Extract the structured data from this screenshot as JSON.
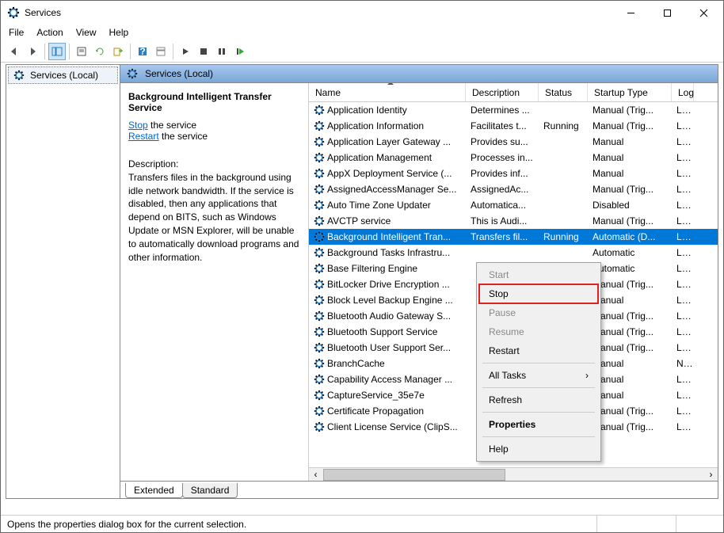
{
  "window": {
    "title": "Services"
  },
  "menu": {
    "file": "File",
    "action": "Action",
    "view": "View",
    "help": "Help"
  },
  "tree": {
    "root": "Services (Local)"
  },
  "contentHeader": "Services (Local)",
  "details": {
    "title": "Background Intelligent Transfer Service",
    "stop": "Stop",
    "stopsuffix": " the service",
    "restart": "Restart",
    "restartsuffix": " the service",
    "descLabel": "Description:",
    "desc": "Transfers files in the background using idle network bandwidth. If the service is disabled, then any applications that depend on BITS, such as Windows Update or MSN Explorer, will be unable to automatically download programs and other information."
  },
  "columns": {
    "name": "Name",
    "desc": "Description",
    "status": "Status",
    "start": "Startup Type",
    "log": "Log"
  },
  "services": [
    {
      "name": "Application Identity",
      "desc": "Determines ...",
      "status": "",
      "start": "Manual (Trig...",
      "log": "Loc"
    },
    {
      "name": "Application Information",
      "desc": "Facilitates t...",
      "status": "Running",
      "start": "Manual (Trig...",
      "log": "Loc"
    },
    {
      "name": "Application Layer Gateway ...",
      "desc": "Provides su...",
      "status": "",
      "start": "Manual",
      "log": "Loc"
    },
    {
      "name": "Application Management",
      "desc": "Processes in...",
      "status": "",
      "start": "Manual",
      "log": "Loc"
    },
    {
      "name": "AppX Deployment Service (...",
      "desc": "Provides inf...",
      "status": "",
      "start": "Manual",
      "log": "Loc"
    },
    {
      "name": "AssignedAccessManager Se...",
      "desc": "AssignedAc...",
      "status": "",
      "start": "Manual (Trig...",
      "log": "Loc"
    },
    {
      "name": "Auto Time Zone Updater",
      "desc": "Automatica...",
      "status": "",
      "start": "Disabled",
      "log": "Loc"
    },
    {
      "name": "AVCTP service",
      "desc": "This is Audi...",
      "status": "",
      "start": "Manual (Trig...",
      "log": "Loc"
    },
    {
      "name": "Background Intelligent Tran...",
      "desc": "Transfers fil...",
      "status": "Running",
      "start": "Automatic (D...",
      "log": "Loc",
      "selected": true
    },
    {
      "name": "Background Tasks Infrastru...",
      "desc": "",
      "status": "",
      "start": "Automatic",
      "log": "Loc"
    },
    {
      "name": "Base Filtering Engine",
      "desc": "",
      "status": "",
      "start": "Automatic",
      "log": "Loc"
    },
    {
      "name": "BitLocker Drive Encryption ...",
      "desc": "",
      "status": "",
      "start": "Manual (Trig...",
      "log": "Loc"
    },
    {
      "name": "Block Level Backup Engine ...",
      "desc": "",
      "status": "",
      "start": "Manual",
      "log": "Loc"
    },
    {
      "name": "Bluetooth Audio Gateway S...",
      "desc": "",
      "status": "",
      "start": "Manual (Trig...",
      "log": "Loc"
    },
    {
      "name": "Bluetooth Support Service",
      "desc": "",
      "status": "",
      "start": "Manual (Trig...",
      "log": "Loc"
    },
    {
      "name": "Bluetooth User Support Ser...",
      "desc": "",
      "status": "",
      "start": "Manual (Trig...",
      "log": "Loc"
    },
    {
      "name": "BranchCache",
      "desc": "",
      "status": "",
      "start": "Manual",
      "log": "Net"
    },
    {
      "name": "Capability Access Manager ...",
      "desc": "",
      "status": "",
      "start": "Manual",
      "log": "Loc"
    },
    {
      "name": "CaptureService_35e7e",
      "desc": "",
      "status": "",
      "start": "Manual",
      "log": "Loc"
    },
    {
      "name": "Certificate Propagation",
      "desc": "",
      "status": "",
      "start": "Manual (Trig...",
      "log": "Loc"
    },
    {
      "name": "Client License Service (ClipS...",
      "desc": "",
      "status": "",
      "start": "Manual (Trig...",
      "log": "Loc"
    }
  ],
  "context": {
    "start": "Start",
    "stop": "Stop",
    "pause": "Pause",
    "resume": "Resume",
    "restart": "Restart",
    "alltasks": "All Tasks",
    "refresh": "Refresh",
    "properties": "Properties",
    "help": "Help"
  },
  "tabs": {
    "extended": "Extended",
    "standard": "Standard"
  },
  "statusbar": "Opens the properties dialog box for the current selection."
}
